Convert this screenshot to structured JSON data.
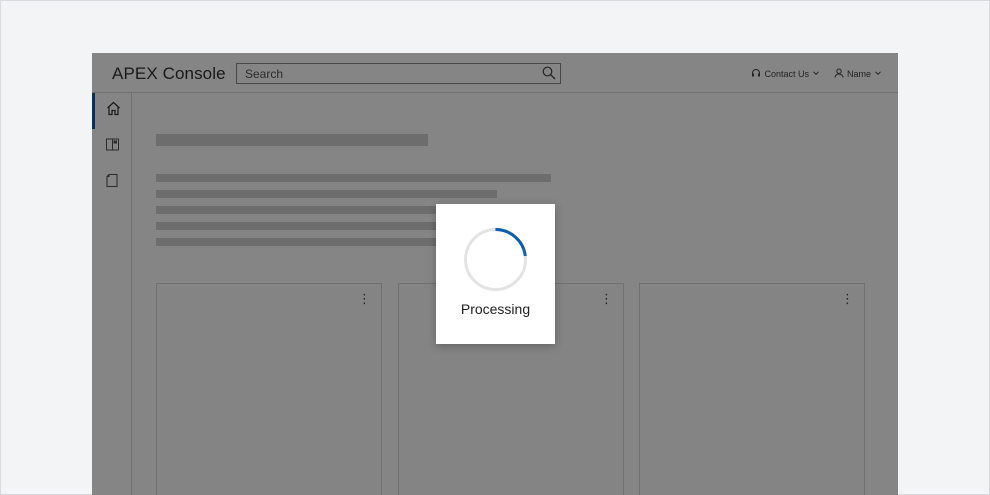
{
  "header": {
    "app_title": "APEX Console",
    "search_placeholder": "Search",
    "contact_label": "Contact Us",
    "user_label": "Name"
  },
  "sidebar": {
    "items": [
      {
        "icon": "home-icon",
        "active": true
      },
      {
        "icon": "dashboard-icon",
        "active": false
      },
      {
        "icon": "document-icon",
        "active": false
      }
    ]
  },
  "cards": [
    {
      "menu_icon": "more-vertical-icon"
    },
    {
      "menu_icon": "more-vertical-icon"
    },
    {
      "menu_icon": "more-vertical-icon"
    }
  ],
  "modal": {
    "status_text": "Processing",
    "spinner_icon": "spinner-icon"
  },
  "colors": {
    "accent": "#0b5fb0",
    "spinner_track": "#e3e3e3",
    "overlay": "rgba(0,0,0,0.48)"
  }
}
